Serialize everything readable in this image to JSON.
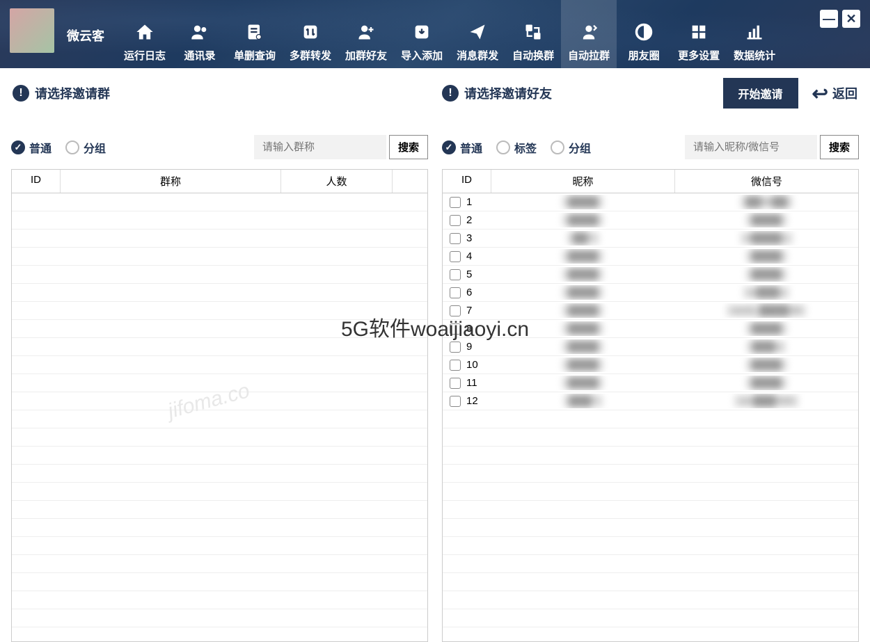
{
  "app_name": "微云客",
  "toolbar": [
    {
      "label": "运行日志",
      "icon": "home"
    },
    {
      "label": "通讯录",
      "icon": "contacts"
    },
    {
      "label": "单删查询",
      "icon": "search-doc"
    },
    {
      "label": "多群转发",
      "icon": "forward"
    },
    {
      "label": "加群好友",
      "icon": "add-user"
    },
    {
      "label": "导入添加",
      "icon": "import"
    },
    {
      "label": "消息群发",
      "icon": "send"
    },
    {
      "label": "自动换群",
      "icon": "swap"
    },
    {
      "label": "自动拉群",
      "icon": "pull",
      "active": true
    },
    {
      "label": "朋友圈",
      "icon": "moments"
    },
    {
      "label": "更多设置",
      "icon": "grid"
    },
    {
      "label": "数据统计",
      "icon": "stats"
    }
  ],
  "left_panel": {
    "title": "请选择邀请群",
    "filters": [
      {
        "label": "普通",
        "selected": true
      },
      {
        "label": "分组",
        "selected": false
      }
    ],
    "search_placeholder": "请输入群称",
    "search_btn": "搜索",
    "columns": [
      "ID",
      "群称",
      "人数",
      ""
    ]
  },
  "right_panel": {
    "title": "请选择邀请好友",
    "filters": [
      {
        "label": "普通",
        "selected": true
      },
      {
        "label": "标签",
        "selected": false
      },
      {
        "label": "分组",
        "selected": false
      }
    ],
    "search_placeholder": "请输入昵称/微信号",
    "search_btn": "搜索",
    "columns": [
      "ID",
      "昵称",
      "微信号"
    ],
    "rows": [
      {
        "id": "1",
        "nick": "████",
        "wx": "██66██"
      },
      {
        "id": "2",
        "nick": "████",
        "wx": "████"
      },
      {
        "id": "3",
        "nick": "██?",
        "wx": "d████1"
      },
      {
        "id": "4",
        "nick": "████",
        "wx": "████"
      },
      {
        "id": "5",
        "nick": "████",
        "wx": "████"
      },
      {
        "id": "6",
        "nick": "████",
        "wx": "w███s"
      },
      {
        "id": "7",
        "nick": "████",
        "wx": "wxid_████38"
      },
      {
        "id": "8",
        "nick": "████",
        "wx": "████"
      },
      {
        "id": "9",
        "nick": "████",
        "wx": "███a"
      },
      {
        "id": "10",
        "nick": "████",
        "wx": "████"
      },
      {
        "id": "11",
        "nick": "████",
        "wx": "████"
      },
      {
        "id": "12",
        "nick": "███?",
        "wx": "xin███999"
      }
    ]
  },
  "actions": {
    "start": "开始邀请",
    "back": "返回"
  },
  "watermark1": "5G软件woaijiaoyi.cn",
  "watermark2": "jifoma.co"
}
